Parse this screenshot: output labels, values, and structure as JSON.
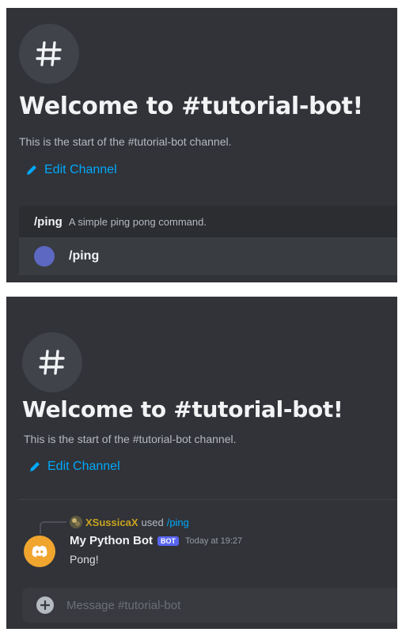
{
  "panel1": {
    "hash_symbol": "#",
    "welcome_title": "Welcome to #tutorial-bot!",
    "start_text": "This is the start of the #tutorial-bot channel.",
    "edit_channel": "Edit Channel",
    "command_header": {
      "command": "/ping",
      "description": "A simple ping pong command."
    },
    "command_option": "/ping"
  },
  "panel2": {
    "hash_symbol": "#",
    "welcome_title": "Welcome to #tutorial-bot!",
    "start_text": "This is the start of the #tutorial-bot channel.",
    "edit_channel": "Edit Channel",
    "reply": {
      "username": "XSussicaX",
      "used_text": "used",
      "command": "/ping"
    },
    "message": {
      "author": "My Python Bot",
      "tag": "BOT",
      "timestamp": "Today at 19:27",
      "content": "Pong!"
    },
    "composer": {
      "placeholder": "Message #tutorial-bot"
    }
  },
  "colors": {
    "background": "#313338",
    "link": "#00a8fc",
    "bot_tag": "#5865f2",
    "bot_avatar": "#f0a52f",
    "username_gold": "#c9a420"
  }
}
